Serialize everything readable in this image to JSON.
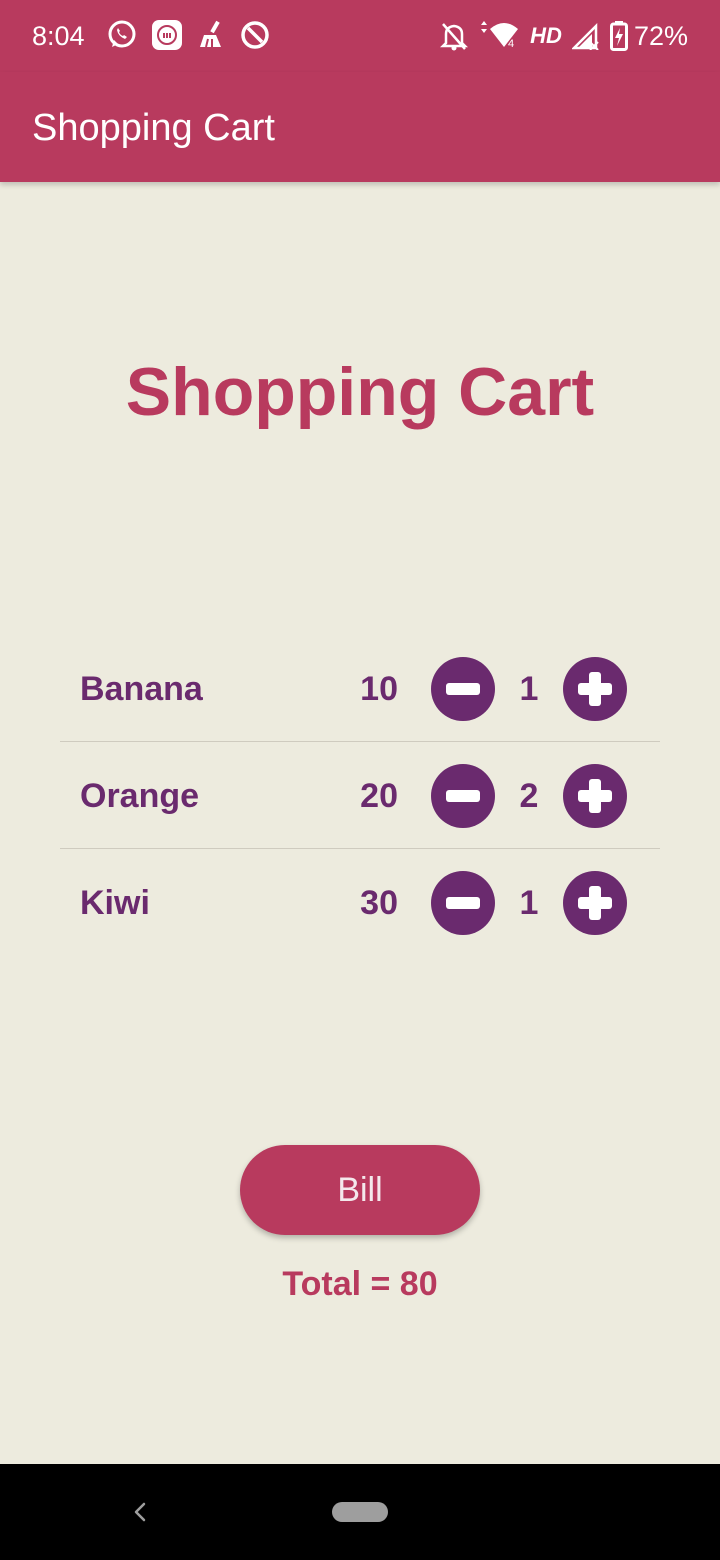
{
  "status_bar": {
    "time": "8:04",
    "left_icons": [
      "whatsapp-icon",
      "mi-icon",
      "cleaner-icon",
      "data-saver-icon"
    ],
    "right_icons": [
      "notifications-off-icon",
      "wifi-icon",
      "signal-icon",
      "battery-charging-icon"
    ],
    "network_label": "HD",
    "battery": "72%"
  },
  "app_bar": {
    "title": "Shopping Cart"
  },
  "page": {
    "heading": "Shopping Cart"
  },
  "products": [
    {
      "name": "Banana",
      "price": "10",
      "quantity": "1"
    },
    {
      "name": "Orange",
      "price": "20",
      "quantity": "2"
    },
    {
      "name": "Kiwi",
      "price": "30",
      "quantity": "1"
    }
  ],
  "actions": {
    "bill_label": "Bill",
    "total_text": "Total = 80"
  },
  "colors": {
    "primary": "#B83A5E",
    "accent": "#6A2A6E",
    "background": "#EDEBDE"
  }
}
